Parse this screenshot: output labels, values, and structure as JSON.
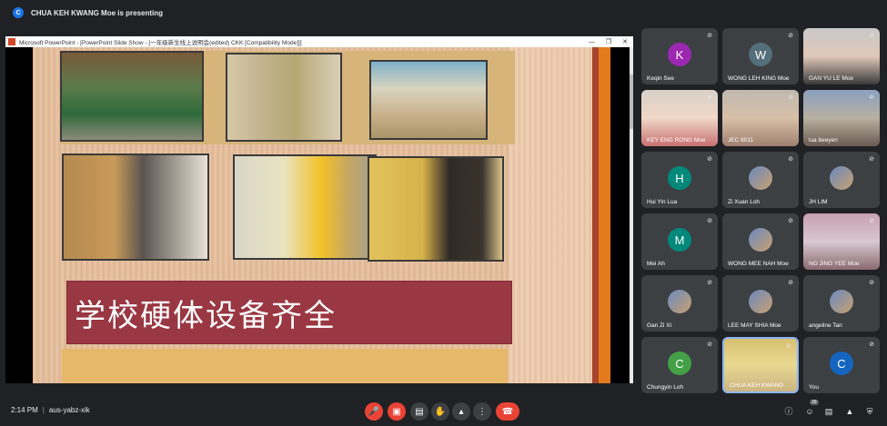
{
  "presenter": {
    "initial": "C",
    "text": "CHUA KEH KWANG Moe is presenting"
  },
  "powerpoint": {
    "window_title": "Microsoft PowerPoint - [PowerPoint Slide Show - [一年级新生线上说明会(edited) CKK [Compatibility Mode]]]",
    "caption": "学校硬体设备齐全"
  },
  "participants": [
    {
      "name": "Keqin See",
      "initial": "K",
      "color": "#9c27b0",
      "type": "avatar"
    },
    {
      "name": "WONG LEH KING Moe",
      "initial": "W",
      "color": "#546e7a",
      "type": "avatar"
    },
    {
      "name": "GAN YU LE Moe",
      "type": "video"
    },
    {
      "name": "KEY ENG RONG Moe",
      "type": "video"
    },
    {
      "name": "JEC 6011",
      "type": "video"
    },
    {
      "name": "lua beeyen",
      "type": "video"
    },
    {
      "name": "Hui Yin Lua",
      "initial": "H",
      "color": "#00897b",
      "type": "avatar"
    },
    {
      "name": "Zi Xuan Loh",
      "type": "image"
    },
    {
      "name": "JH LIM",
      "type": "image"
    },
    {
      "name": "Mei Ah",
      "initial": "M",
      "color": "#00897b",
      "type": "avatar"
    },
    {
      "name": "WONG MEE NAH Moe",
      "type": "image"
    },
    {
      "name": "NG JING YEE Moe",
      "type": "video"
    },
    {
      "name": "Gan Zi Xi",
      "type": "image"
    },
    {
      "name": "LEE MAY SHIA Moe",
      "type": "image"
    },
    {
      "name": "angeline Tan",
      "type": "image"
    },
    {
      "name": "Chungyin Loh",
      "initial": "C",
      "color": "#43a047",
      "type": "avatar"
    },
    {
      "name": "CHUA KEH KWANG",
      "type": "video"
    },
    {
      "name": "You",
      "initial": "C",
      "color": "#1565c0",
      "type": "avatar"
    }
  ],
  "bottombar": {
    "time": "2:14 PM",
    "meeting_code": "aus-yabz-xik",
    "people_count": "39"
  },
  "colors": {
    "end_call": "#ea4335",
    "accent": "#8ab4f8"
  }
}
